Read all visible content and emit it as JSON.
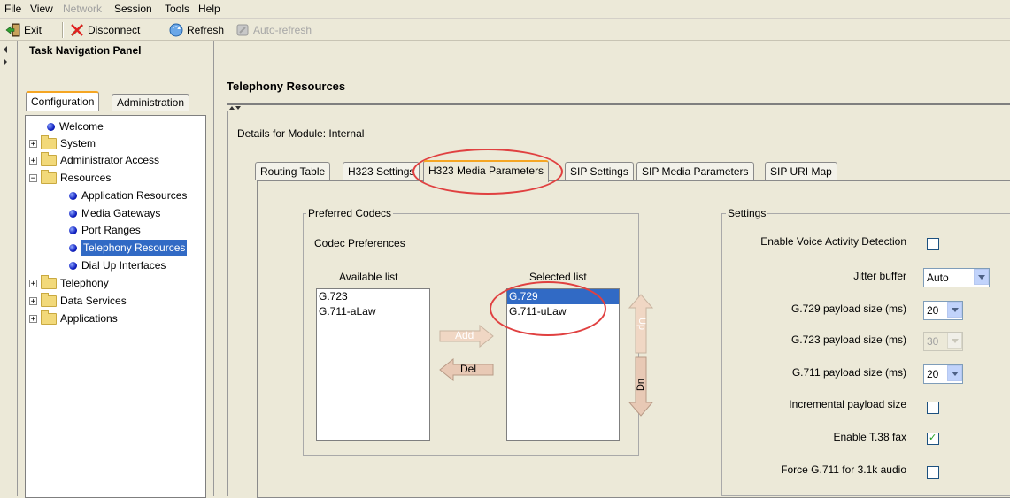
{
  "menu": [
    "File",
    "View",
    "Network",
    "Session",
    "Tools",
    "Help"
  ],
  "toolbar": {
    "exit": "Exit",
    "disconnect": "Disconnect",
    "refresh": "Refresh",
    "autorefresh": "Auto-refresh"
  },
  "nav": {
    "title": "Task Navigation Panel",
    "tabs": [
      "Configuration",
      "Administration"
    ],
    "tree": [
      {
        "label": "Welcome"
      },
      {
        "label": "System"
      },
      {
        "label": "Administrator Access"
      },
      {
        "label": "Resources"
      },
      {
        "label": "Application Resources"
      },
      {
        "label": "Media Gateways"
      },
      {
        "label": "Port Ranges"
      },
      {
        "label": "Telephony Resources"
      },
      {
        "label": "Dial Up Interfaces"
      },
      {
        "label": "Telephony"
      },
      {
        "label": "Data Services"
      },
      {
        "label": "Applications"
      }
    ]
  },
  "main": {
    "title": "Telephony Resources",
    "module_details": "Details for Module: Internal",
    "tabs": [
      "Routing Table",
      "H323 Settings",
      "H323 Media Parameters",
      "SIP Settings",
      "SIP Media Parameters",
      "SIP URI Map"
    ]
  },
  "codecs": {
    "group_label": "Preferred Codecs",
    "preferences_label": "Codec Preferences",
    "available_label": "Available list",
    "selected_label": "Selected list",
    "available": [
      "G.723",
      "G.711-aLaw"
    ],
    "selected": [
      "G.729",
      "G.711-uLaw"
    ],
    "add": "Add",
    "del": "Del",
    "up": "Up",
    "dn": "Dn"
  },
  "settings": {
    "group_label": "Settings",
    "vad_label": "Enable Voice Activity Detection",
    "jitter_label": "Jitter buffer",
    "jitter_value": "Auto",
    "g729_label": "G.729 payload size (ms)",
    "g729_value": "20",
    "g723_label": "G.723 payload size (ms)",
    "g723_value": "30",
    "g711_label": "G.711 payload size (ms)",
    "g711_value": "20",
    "incremental_label": "Incremental payload size",
    "t38_label": "Enable T.38 fax",
    "force_label": "Force G.711 for 3.1k audio"
  }
}
